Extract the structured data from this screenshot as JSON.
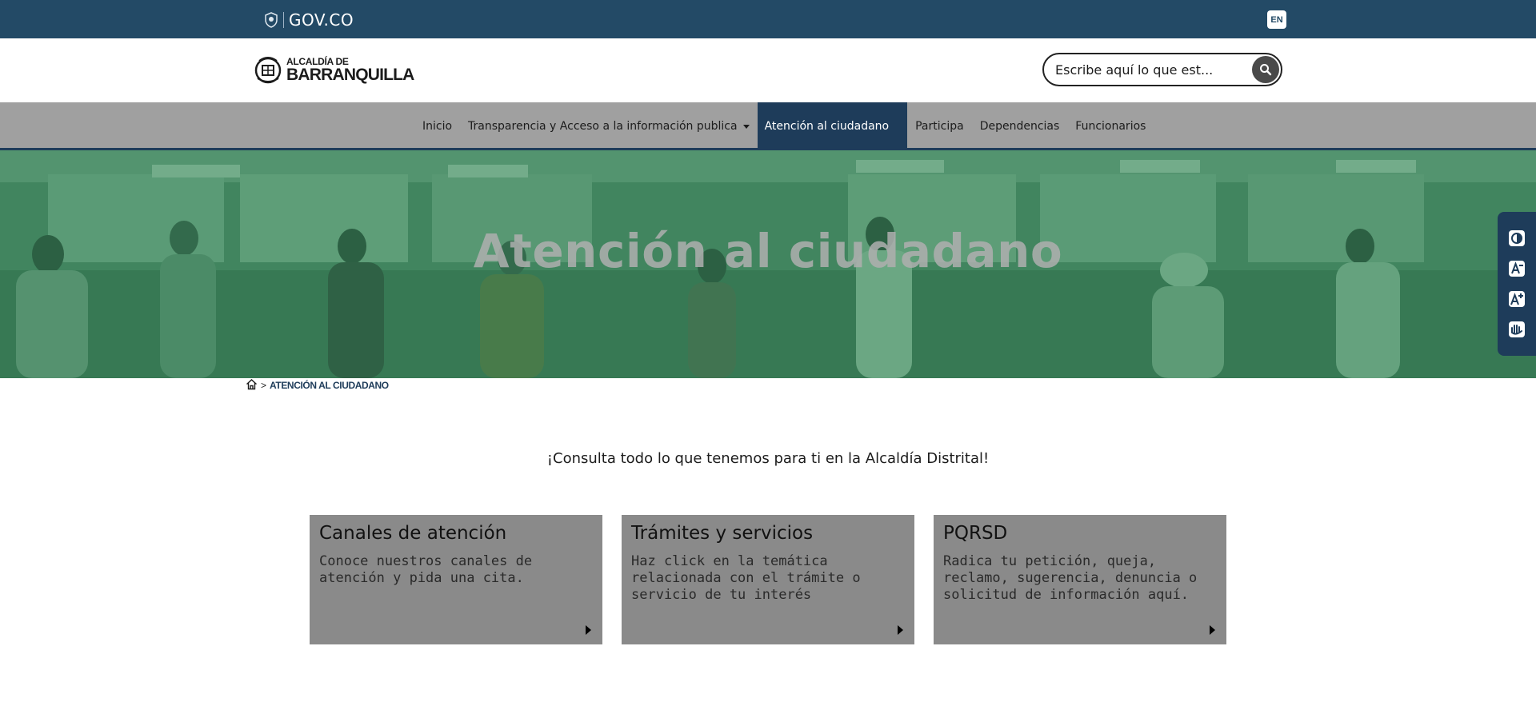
{
  "govbar": {
    "logo_text": "GOV.CO",
    "lang_label": "EN"
  },
  "header": {
    "brand_top": "ALCALDÍA DE",
    "brand_main": "BARRANQUILLA",
    "search_placeholder": "Escribe aquí lo que est..."
  },
  "nav": {
    "items": [
      {
        "label": "Inicio"
      },
      {
        "label": "Transparencia y Acceso a la información publica"
      },
      {
        "label": "Atención al ciudadano"
      },
      {
        "label": "Participa"
      },
      {
        "label": "Dependencias"
      },
      {
        "label": "Funcionarios"
      }
    ]
  },
  "hero": {
    "title": "Atención al ciudadano"
  },
  "breadcrumb": {
    "separator": ">",
    "current": "ATENCIÓN AL CIUDADANO"
  },
  "intro": "¡Consulta todo lo que tenemos para ti en la Alcaldía Distrital!",
  "cards": [
    {
      "title": "Canales de atención",
      "desc": "Conoce nuestros canales de atención y pida una cita."
    },
    {
      "title": "Trámites y servicios",
      "desc": "Haz click en la temática relacionada con el trámite o servicio de tu interés"
    },
    {
      "title": "PQRSD",
      "desc": "Radica tu petición, queja, reclamo, sugerencia, denuncia o solicitud de información aquí."
    }
  ],
  "accessibility": {
    "tools": [
      "contrast-icon",
      "decrease-font-icon",
      "increase-font-icon",
      "sign-language-icon"
    ]
  },
  "colors": {
    "govbar": "#234a66",
    "nav_bg": "#a0a0a0",
    "nav_active": "#1e3c5a",
    "card_bg": "#8a8a8a",
    "hero_tint": "#3e7a5c"
  }
}
